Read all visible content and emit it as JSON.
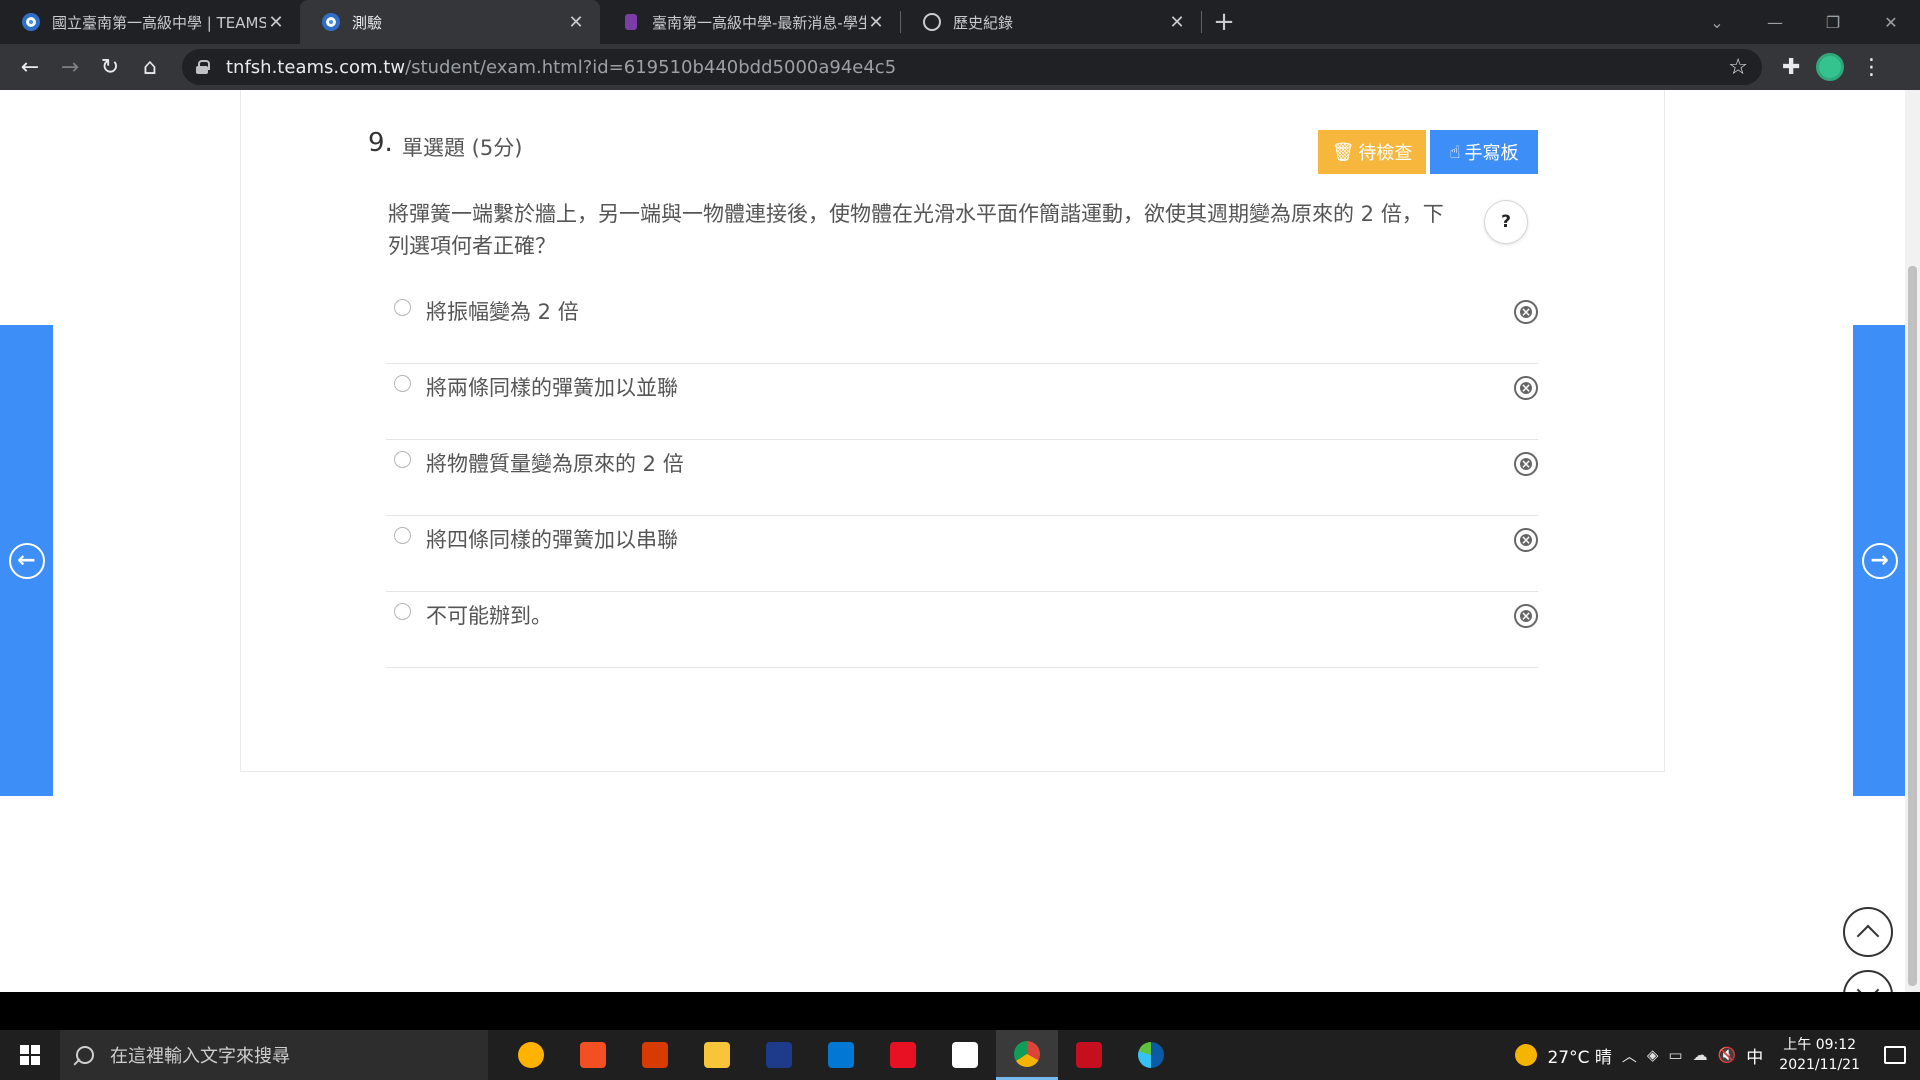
{
  "browser": {
    "tabs": [
      {
        "title": "國立臺南第一高級中學 | TEAMS",
        "icon": "teams-icon",
        "active": false
      },
      {
        "title": "測驗",
        "icon": "teams-icon",
        "active": true
      },
      {
        "title": "臺南第一高級中學-最新消息-學生",
        "icon": "school-icon",
        "active": false
      },
      {
        "title": "歷史紀錄",
        "icon": "history-icon",
        "active": false
      }
    ],
    "url_host": "tnfsh.teams.com.tw",
    "url_path": "/student/exam.html?id=619510b440bdd5000a94e4c5"
  },
  "question": {
    "number": "9.",
    "type": "單選題 (5分)",
    "text": "將彈簧一端繫於牆上，另一端與一物體連接後，使物體在光滑水平面作簡諧運動，欲使其週期變為原來的 2 倍，下列選項何者正確？",
    "check_label": "待檢查",
    "pad_label": "手寫板",
    "help_label": "?"
  },
  "options": [
    "將振幅變為 2 倍",
    "將兩條同樣的彈簧加以並聯",
    "將物體質量變為原來的 2 倍",
    "將四條同樣的彈簧加以串聯",
    "不可能辦到。"
  ],
  "taskbar": {
    "search_placeholder": "在這裡輸入文字來搜尋",
    "weather": "27°C 晴",
    "ime": "中",
    "time": "上午 09:12",
    "date": "2021/11/21"
  },
  "colors": {
    "accent_blue": "#3e8ef7",
    "accent_orange": "#f6b73c"
  }
}
